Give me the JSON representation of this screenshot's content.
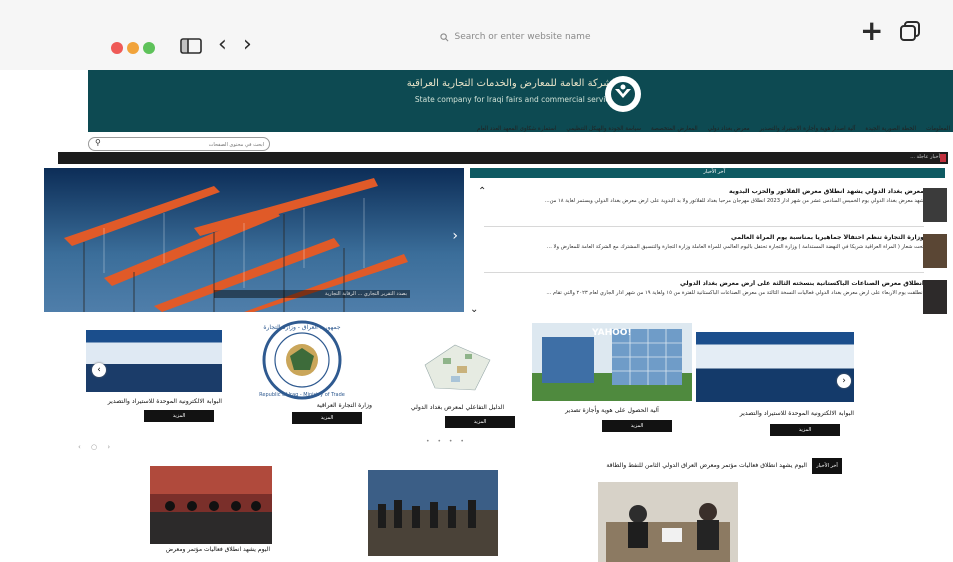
{
  "browser": {
    "address_placeholder": "Search or enter website name"
  },
  "header": {
    "title_ar": "الشركة العامة للمعارض والخدمات التجارية العراقية",
    "title_en": "State company for Iraqi fairs and commercial services"
  },
  "menu": {
    "items": [
      "المعلومات",
      "الخطة الصورية الجيدة",
      "آلية اصدار هوية وأجازة الاستيراد والتصدير",
      "معرض بغداد دولي",
      "المعارض المتخصصة",
      "سياسة الجودة والهيكل التنظيمي",
      "استمارة شكاوى المعهد العدد العام"
    ],
    "search_placeholder": "أبحث في محتوى الصفحات"
  },
  "ticker": {
    "text": "أخبار عاجلة ..."
  },
  "hero": {
    "caption": "بصدد التقرير التجاري ... الرقابة التجارية"
  },
  "news": {
    "header_label": "آخر الأخبار",
    "items": [
      {
        "title": "معرض بغداد الدولي يشهد انطلاق معرض الفلاتور والحزب البدوية",
        "body": "شهد معرض بغداد الدولي يوم الخميس السادس عشر من شهر آذار 2023 انطلاق مهرجان مرحبا بغداد للفلاتور ولا بد البدوية على أرض معرض بغداد الدولي ويستمر لغاية ١٨ من..."
      },
      {
        "title": "وزارة التجارة تنظم احتفالاً جماهيرياً بمناسبة يوم المرأة العالمي",
        "body": "تحت شعار ( المرأة العراقية شريكاً في النهضة المستدامة ) وزارة التجارة تحتفل باليوم العالمي للمرأة العاملة وزارة التجارة والتنسيق المشترك مع الشركة العامة للمعارض ولا ..."
      },
      {
        "title": "انطلاق معرض الصناعات الباكستانية بنسخته الثالثة على أرض معرض بغداد الدولي",
        "body": "أنطلقت يوم الاربعاء على أرض معرض بغداد الدولي فعاليات النسخة الثالثة من معرض الصناعات الباكستانية للفترة من ١٥ ولغاية ١٩ من شهر آذار الجاري لعام ٢٠٢٣ والتي تقام ..."
      }
    ]
  },
  "services": {
    "cards": [
      {
        "title": "البوابة الالكترونية الموحدة للاستيراد والتصدير",
        "button": "المزيد"
      },
      {
        "title": "آلية الحصول على هوية وأجازة تصدير",
        "button": "المزيد"
      },
      {
        "title": "الدليل التفاعلي لمعرض بغداد الدولي",
        "button": "المزيد"
      },
      {
        "title": "وزارة التجارة العراقية",
        "button": "المزيد"
      },
      {
        "title": "البوابة الالكترونية الموحدة للاستيراد والتصدير",
        "button": "المزيد"
      }
    ],
    "seal_text": "جمهورية العراق - وزارة التجارة",
    "seal_text_en": "Republic of Iraq - Ministry of Trade",
    "yahoo_label": "YAHOO!",
    "pager": "• • • •",
    "small_pager": "‹ ○ ›"
  },
  "latest": {
    "badge": "آخر الأخبار",
    "title": "اليوم يشهد انطلاق فعاليات مؤتمر ومعرض العراق الدولي الثامن للنفط والطاقة",
    "caption": "اليوم يشهد انطلاق فعاليات مؤتمر ومعرض"
  },
  "icons": {
    "back": "chevron-left-icon",
    "forward": "chevron-right-icon",
    "search": "search-icon",
    "new_tab": "plus-icon",
    "tabs": "tabs-icon"
  },
  "colors": {
    "header_bg": "#0d4a52",
    "news_header_bg": "#0e5a62",
    "button_bg": "#121212"
  }
}
